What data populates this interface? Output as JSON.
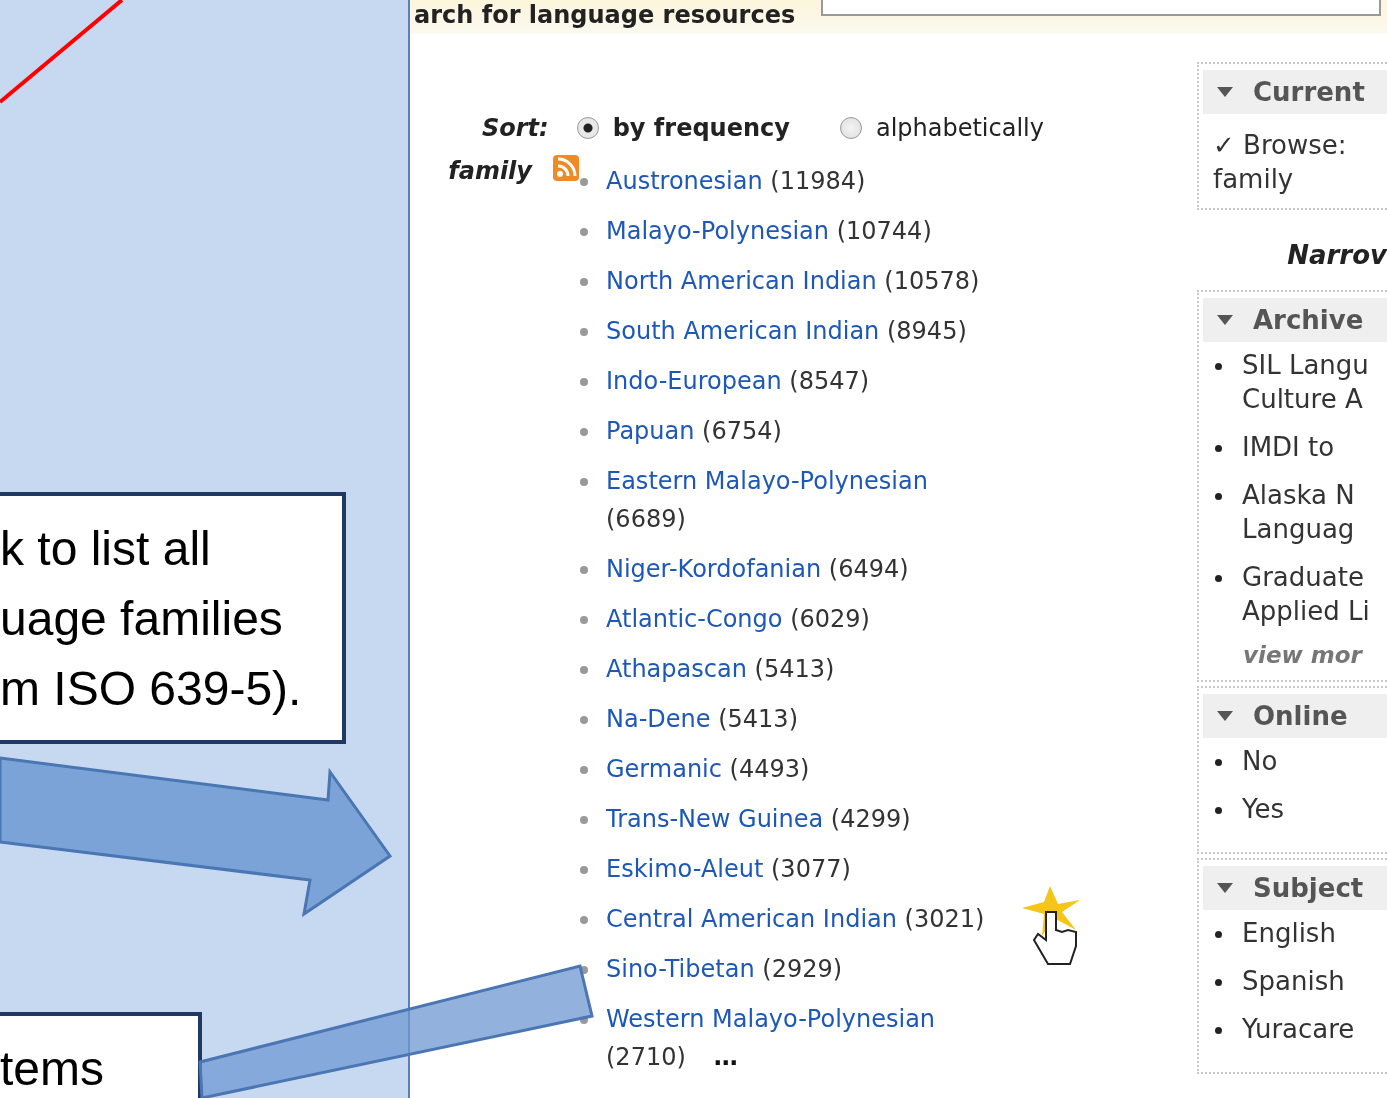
{
  "slide": {
    "callouts": [
      {
        "lines": [
          "k to list all",
          "uage families",
          "m ISO 639-5)."
        ]
      },
      {
        "lines": [
          "tems"
        ]
      }
    ]
  },
  "page": {
    "header": {
      "title": "arch for language resources"
    },
    "sort": {
      "label": "Sort:",
      "options": [
        {
          "label": "by frequency",
          "selected": true
        },
        {
          "label": "alphabetically",
          "selected": false
        }
      ]
    },
    "facet_label": "family",
    "families": [
      {
        "name": "Austronesian",
        "count": "(11984)"
      },
      {
        "name": "Malayo-Polynesian",
        "count": "(10744)"
      },
      {
        "name": "North American Indian",
        "count": "(10578)"
      },
      {
        "name": "South American Indian",
        "count": "(8945)"
      },
      {
        "name": "Indo-European",
        "count": "(8547)"
      },
      {
        "name": "Papuan",
        "count": "(6754)"
      },
      {
        "name": "Eastern Malayo-Polynesian",
        "count": "(6689)"
      },
      {
        "name": "Niger-Kordofanian",
        "count": "(6494)"
      },
      {
        "name": "Atlantic-Congo",
        "count": "(6029)"
      },
      {
        "name": "Athapascan",
        "count": "(5413)"
      },
      {
        "name": "Na-Dene",
        "count": "(5413)"
      },
      {
        "name": "Germanic",
        "count": "(4493)"
      },
      {
        "name": "Trans-New Guinea",
        "count": "(4299)"
      },
      {
        "name": "Eskimo-Aleut",
        "count": "(3077)"
      },
      {
        "name": "Central American Indian",
        "count": "(3021)"
      },
      {
        "name": "Sino-Tibetan",
        "count": "(2929)"
      },
      {
        "name": "Western Malayo-Polynesian",
        "count": "(2710)"
      }
    ],
    "more": "…",
    "sidebar": {
      "current": {
        "title": "Current",
        "expanded": true,
        "lines": [
          "✓ Browse:",
          "family"
        ]
      },
      "narrow_label": "Narrov",
      "facets": [
        {
          "title": "Archive",
          "expanded": true,
          "items": [
            {
              "lines": [
                "SIL Langu",
                "Culture A"
              ]
            },
            {
              "lines": [
                "IMDI to"
              ]
            },
            {
              "lines": [
                "Alaska N",
                "Languag"
              ]
            },
            {
              "lines": [
                "Graduate",
                "Applied Li"
              ]
            }
          ],
          "more": "view mor"
        },
        {
          "title": "Online",
          "expanded": true,
          "items": [
            {
              "lines": [
                "No"
              ]
            },
            {
              "lines": [
                "Yes"
              ]
            }
          ]
        },
        {
          "title": "Subject",
          "expanded": true,
          "items": [
            {
              "lines": [
                "English"
              ]
            },
            {
              "lines": [
                "Spanish"
              ]
            },
            {
              "lines": [
                "Yuracare"
              ]
            }
          ]
        }
      ]
    }
  }
}
